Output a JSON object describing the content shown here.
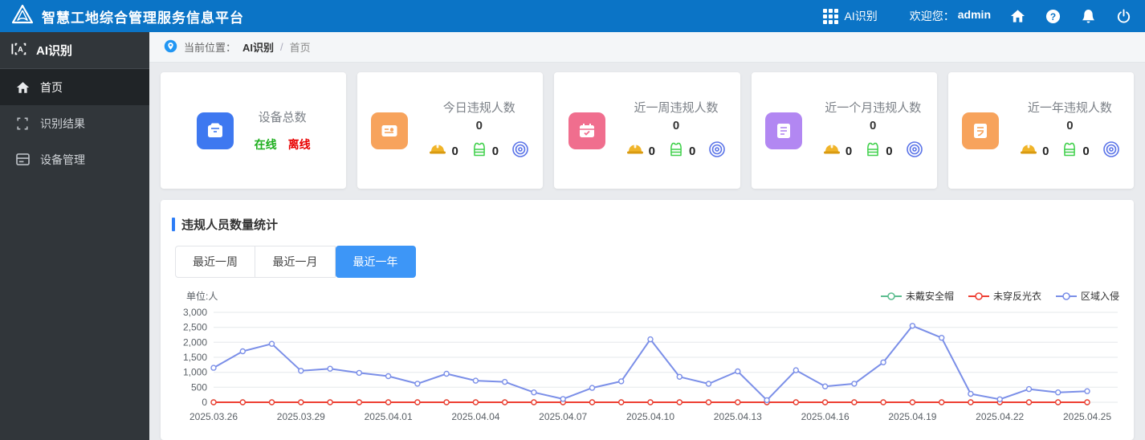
{
  "header": {
    "title": "智慧工地综合管理服务信息平台",
    "app_switcher": {
      "label": "AI识别",
      "icon": "apps-grid-icon"
    },
    "welcome_label": "欢迎您：",
    "username": "admin",
    "action_icons": [
      "home-icon",
      "help-icon",
      "bell-icon",
      "power-icon"
    ],
    "bar_color": "#0b74c6"
  },
  "sidebar": {
    "title": "AI识别",
    "title_icon": "ai-scan-icon",
    "items": [
      {
        "label": "首页",
        "icon": "home-icon",
        "active": true
      },
      {
        "label": "识别结果",
        "icon": "scan-frame-icon",
        "active": false
      },
      {
        "label": "设备管理",
        "icon": "device-icon",
        "active": false
      }
    ]
  },
  "breadcrumb": {
    "icon": "location-pin-icon",
    "prefix": "当前位置：",
    "root": "AI识别",
    "separator": "/",
    "current": "首页"
  },
  "stats": {
    "device_card": {
      "title": "设备总数",
      "online_label": "在线",
      "offline_label": "离线",
      "icon": "device-archive-icon",
      "icon_color": "#3e78f0",
      "online_color": "#1faf1f",
      "offline_color": "#e80000"
    },
    "violation_cards": [
      {
        "title": "今日违规人数",
        "total": "0",
        "helmet_count": "0",
        "vest_count": "0",
        "icon": "id-card-icon",
        "icon_color": "#f7a35c"
      },
      {
        "title": "近一周违规人数",
        "total": "0",
        "helmet_count": "0",
        "vest_count": "0",
        "icon": "calendar-icon",
        "icon_color": "#f06e8e"
      },
      {
        "title": "近一个月违规人数",
        "total": "0",
        "helmet_count": "0",
        "vest_count": "0",
        "icon": "report-icon",
        "icon_color": "#b287f2"
      },
      {
        "title": "近一年违规人数",
        "total": "0",
        "helmet_count": "0",
        "vest_count": "0",
        "icon": "document-icon",
        "icon_color": "#f7a35c"
      }
    ],
    "mini_icons": {
      "helmet": "helmet-icon",
      "vest": "vest-icon",
      "intrusion": "spiral-icon"
    }
  },
  "chart_section": {
    "title": "违规人员数量统计",
    "tabs": [
      {
        "label": "最近一周",
        "active": false
      },
      {
        "label": "最近一月",
        "active": false
      },
      {
        "label": "最近一年",
        "active": true
      }
    ],
    "unit_label": "单位:人",
    "active_tab_color": "#3d96f7"
  },
  "chart_data": {
    "type": "line",
    "title": "违规人员数量统计",
    "ylabel": "单位:人",
    "ylim": [
      0,
      3000
    ],
    "y_ticks": [
      0,
      500,
      1000,
      1500,
      2000,
      2500,
      3000
    ],
    "x_label_every": 3,
    "grid": "horizontal",
    "legend_position": "top-right",
    "x": [
      "2025.03.26",
      "2025.03.27",
      "2025.03.28",
      "2025.03.29",
      "2025.03.30",
      "2025.03.31",
      "2025.04.01",
      "2025.04.02",
      "2025.04.03",
      "2025.04.04",
      "2025.04.05",
      "2025.04.06",
      "2025.04.07",
      "2025.04.08",
      "2025.04.09",
      "2025.04.10",
      "2025.04.11",
      "2025.04.12",
      "2025.04.13",
      "2025.04.14",
      "2025.04.15",
      "2025.04.16",
      "2025.04.17",
      "2025.04.18",
      "2025.04.19",
      "2025.04.20",
      "2025.04.21",
      "2025.04.22",
      "2025.04.23",
      "2025.04.24",
      "2025.04.25"
    ],
    "series": [
      {
        "name": "未戴安全帽",
        "color": "#5cbd8f",
        "values": [
          0,
          0,
          0,
          0,
          0,
          0,
          0,
          0,
          0,
          0,
          0,
          0,
          0,
          0,
          0,
          0,
          0,
          0,
          0,
          0,
          0,
          0,
          0,
          0,
          0,
          0,
          0,
          0,
          0,
          0,
          0
        ]
      },
      {
        "name": "未穿反光衣",
        "color": "#ee3f33",
        "values": [
          0,
          0,
          0,
          0,
          0,
          0,
          0,
          0,
          0,
          0,
          0,
          0,
          0,
          0,
          0,
          0,
          0,
          0,
          0,
          0,
          0,
          0,
          0,
          0,
          0,
          0,
          0,
          0,
          0,
          0,
          0
        ]
      },
      {
        "name": "区域入侵",
        "color": "#7b8fe8",
        "values": [
          1150,
          1700,
          1950,
          1050,
          1120,
          980,
          870,
          620,
          950,
          720,
          680,
          330,
          110,
          480,
          700,
          2100,
          850,
          615,
          1030,
          70,
          1070,
          530,
          620,
          1330,
          2550,
          2150,
          280,
          100,
          440,
          330,
          370
        ]
      }
    ]
  }
}
